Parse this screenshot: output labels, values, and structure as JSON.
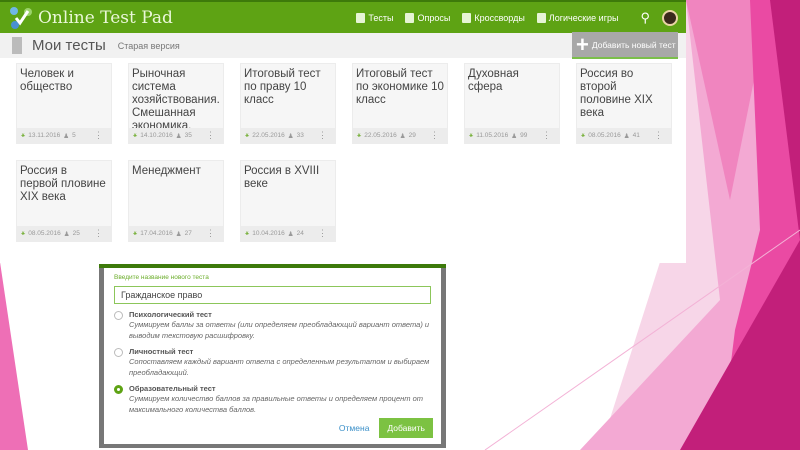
{
  "header": {
    "logo": "Online Test Pad",
    "nav": [
      "Тесты",
      "Опросы",
      "Кроссворды",
      "Логические игры"
    ]
  },
  "subbar": {
    "title": "Мои тесты",
    "old_version": "Старая версия",
    "add_button": "Добавить новый тест"
  },
  "tests": [
    {
      "title": "Человек и обществo",
      "date": "13.11.2016",
      "count": "5"
    },
    {
      "title": "Рыночная система хозяйствования. Смешанная экономика.",
      "date": "14.10.2016",
      "count": "35"
    },
    {
      "title": "Итоговый тест по праву 10 класс",
      "date": "22.05.2016",
      "count": "33"
    },
    {
      "title": "Итоговый тест по экономике 10 класс",
      "date": "22.05.2016",
      "count": "29"
    },
    {
      "title": "Духовная сфера",
      "date": "11.05.2016",
      "count": "99"
    },
    {
      "title": "Россия во второй половине XIX века",
      "date": "08.05.2016",
      "count": "41"
    },
    {
      "title": "Россия в первой пловине XIX века",
      "date": "08.05.2016",
      "count": "25"
    },
    {
      "title": "Менеджмент",
      "date": "17.04.2016",
      "count": "27"
    },
    {
      "title": "Россия в XVIII веке",
      "date": "10.04.2016",
      "count": "24"
    }
  ],
  "modal": {
    "label": "Введите название нового теста",
    "value": "Гражданское право",
    "options": [
      {
        "title": "Психологический тест",
        "desc": "Суммируем баллы за ответы (или определяем преобладающий вариант ответа) и выводим текстовую расшифровку."
      },
      {
        "title": "Личностный тест",
        "desc": "Сопоставляем каждый вариант ответа с определенным результатом и выбираем преобладающий."
      },
      {
        "title": "Образовательный тест",
        "desc": "Суммируем количество баллов за правильные ответы и определяем процент от максимального количества баллов."
      }
    ],
    "selected": "Образовательный тест",
    "cancel": "Отмена",
    "submit": "Добавить"
  },
  "colors": {
    "brand": "#5ea314",
    "pink": "#c21f7a"
  }
}
